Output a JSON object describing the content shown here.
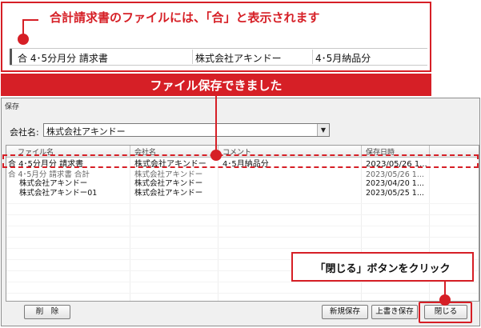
{
  "top_callout": {
    "note": "合計請求書のファイルには、「合」と表示されます",
    "row": {
      "file_name": "合 4･5分月分 請求書",
      "company": "株式会社アキンドー",
      "comment": "4･5月納品分"
    }
  },
  "banner": {
    "text": "ファイル保存できました"
  },
  "dialog": {
    "title": "保存",
    "company_label": "会社名:",
    "company_value": "株式会社アキンドー",
    "columns": [
      "ファイル名",
      "会社名",
      "コメント",
      "保存日時"
    ],
    "rows": [
      {
        "file_name": "合 4･5分月分 請求書",
        "company": "株式会社アキンドー",
        "comment": "4･5月納品分",
        "saved": "2023/05/26 1...",
        "selected": true
      },
      {
        "file_name": "合 4･5月分 請求書 合計",
        "company": "株式会社アキンドー",
        "comment": "",
        "saved": "2023/05/26 1...",
        "selected": false
      },
      {
        "file_name": "株式会社アキンドー",
        "company": "株式会社アキンドー",
        "comment": "",
        "saved": "2023/04/20 1...",
        "selected": false
      },
      {
        "file_name": "株式会社アキンドー01",
        "company": "株式会社アキンドー",
        "comment": "",
        "saved": "2023/05/25 1...",
        "selected": false
      }
    ],
    "buttons": {
      "delete": "削　除",
      "new_save": "新規保存",
      "overwrite_save": "上書き保存",
      "close": "閉じる"
    }
  },
  "close_callout": {
    "text": "「閉じる」ボタンをクリック"
  },
  "colors": {
    "accent": "#d61f26"
  }
}
